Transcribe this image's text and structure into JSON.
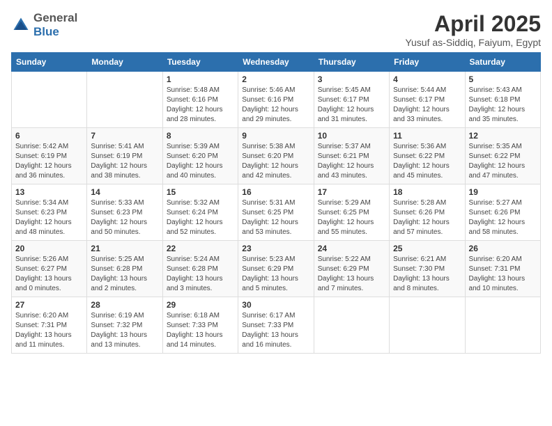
{
  "header": {
    "logo_general": "General",
    "logo_blue": "Blue",
    "title": "April 2025",
    "location": "Yusuf as-Siddiq, Faiyum, Egypt"
  },
  "calendar": {
    "days_of_week": [
      "Sunday",
      "Monday",
      "Tuesday",
      "Wednesday",
      "Thursday",
      "Friday",
      "Saturday"
    ],
    "weeks": [
      [
        {
          "day": "",
          "info": ""
        },
        {
          "day": "",
          "info": ""
        },
        {
          "day": "1",
          "info": "Sunrise: 5:48 AM\nSunset: 6:16 PM\nDaylight: 12 hours and 28 minutes."
        },
        {
          "day": "2",
          "info": "Sunrise: 5:46 AM\nSunset: 6:16 PM\nDaylight: 12 hours and 29 minutes."
        },
        {
          "day": "3",
          "info": "Sunrise: 5:45 AM\nSunset: 6:17 PM\nDaylight: 12 hours and 31 minutes."
        },
        {
          "day": "4",
          "info": "Sunrise: 5:44 AM\nSunset: 6:17 PM\nDaylight: 12 hours and 33 minutes."
        },
        {
          "day": "5",
          "info": "Sunrise: 5:43 AM\nSunset: 6:18 PM\nDaylight: 12 hours and 35 minutes."
        }
      ],
      [
        {
          "day": "6",
          "info": "Sunrise: 5:42 AM\nSunset: 6:19 PM\nDaylight: 12 hours and 36 minutes."
        },
        {
          "day": "7",
          "info": "Sunrise: 5:41 AM\nSunset: 6:19 PM\nDaylight: 12 hours and 38 minutes."
        },
        {
          "day": "8",
          "info": "Sunrise: 5:39 AM\nSunset: 6:20 PM\nDaylight: 12 hours and 40 minutes."
        },
        {
          "day": "9",
          "info": "Sunrise: 5:38 AM\nSunset: 6:20 PM\nDaylight: 12 hours and 42 minutes."
        },
        {
          "day": "10",
          "info": "Sunrise: 5:37 AM\nSunset: 6:21 PM\nDaylight: 12 hours and 43 minutes."
        },
        {
          "day": "11",
          "info": "Sunrise: 5:36 AM\nSunset: 6:22 PM\nDaylight: 12 hours and 45 minutes."
        },
        {
          "day": "12",
          "info": "Sunrise: 5:35 AM\nSunset: 6:22 PM\nDaylight: 12 hours and 47 minutes."
        }
      ],
      [
        {
          "day": "13",
          "info": "Sunrise: 5:34 AM\nSunset: 6:23 PM\nDaylight: 12 hours and 48 minutes."
        },
        {
          "day": "14",
          "info": "Sunrise: 5:33 AM\nSunset: 6:23 PM\nDaylight: 12 hours and 50 minutes."
        },
        {
          "day": "15",
          "info": "Sunrise: 5:32 AM\nSunset: 6:24 PM\nDaylight: 12 hours and 52 minutes."
        },
        {
          "day": "16",
          "info": "Sunrise: 5:31 AM\nSunset: 6:25 PM\nDaylight: 12 hours and 53 minutes."
        },
        {
          "day": "17",
          "info": "Sunrise: 5:29 AM\nSunset: 6:25 PM\nDaylight: 12 hours and 55 minutes."
        },
        {
          "day": "18",
          "info": "Sunrise: 5:28 AM\nSunset: 6:26 PM\nDaylight: 12 hours and 57 minutes."
        },
        {
          "day": "19",
          "info": "Sunrise: 5:27 AM\nSunset: 6:26 PM\nDaylight: 12 hours and 58 minutes."
        }
      ],
      [
        {
          "day": "20",
          "info": "Sunrise: 5:26 AM\nSunset: 6:27 PM\nDaylight: 13 hours and 0 minutes."
        },
        {
          "day": "21",
          "info": "Sunrise: 5:25 AM\nSunset: 6:28 PM\nDaylight: 13 hours and 2 minutes."
        },
        {
          "day": "22",
          "info": "Sunrise: 5:24 AM\nSunset: 6:28 PM\nDaylight: 13 hours and 3 minutes."
        },
        {
          "day": "23",
          "info": "Sunrise: 5:23 AM\nSunset: 6:29 PM\nDaylight: 13 hours and 5 minutes."
        },
        {
          "day": "24",
          "info": "Sunrise: 5:22 AM\nSunset: 6:29 PM\nDaylight: 13 hours and 7 minutes."
        },
        {
          "day": "25",
          "info": "Sunrise: 6:21 AM\nSunset: 7:30 PM\nDaylight: 13 hours and 8 minutes."
        },
        {
          "day": "26",
          "info": "Sunrise: 6:20 AM\nSunset: 7:31 PM\nDaylight: 13 hours and 10 minutes."
        }
      ],
      [
        {
          "day": "27",
          "info": "Sunrise: 6:20 AM\nSunset: 7:31 PM\nDaylight: 13 hours and 11 minutes."
        },
        {
          "day": "28",
          "info": "Sunrise: 6:19 AM\nSunset: 7:32 PM\nDaylight: 13 hours and 13 minutes."
        },
        {
          "day": "29",
          "info": "Sunrise: 6:18 AM\nSunset: 7:33 PM\nDaylight: 13 hours and 14 minutes."
        },
        {
          "day": "30",
          "info": "Sunrise: 6:17 AM\nSunset: 7:33 PM\nDaylight: 13 hours and 16 minutes."
        },
        {
          "day": "",
          "info": ""
        },
        {
          "day": "",
          "info": ""
        },
        {
          "day": "",
          "info": ""
        }
      ]
    ]
  }
}
